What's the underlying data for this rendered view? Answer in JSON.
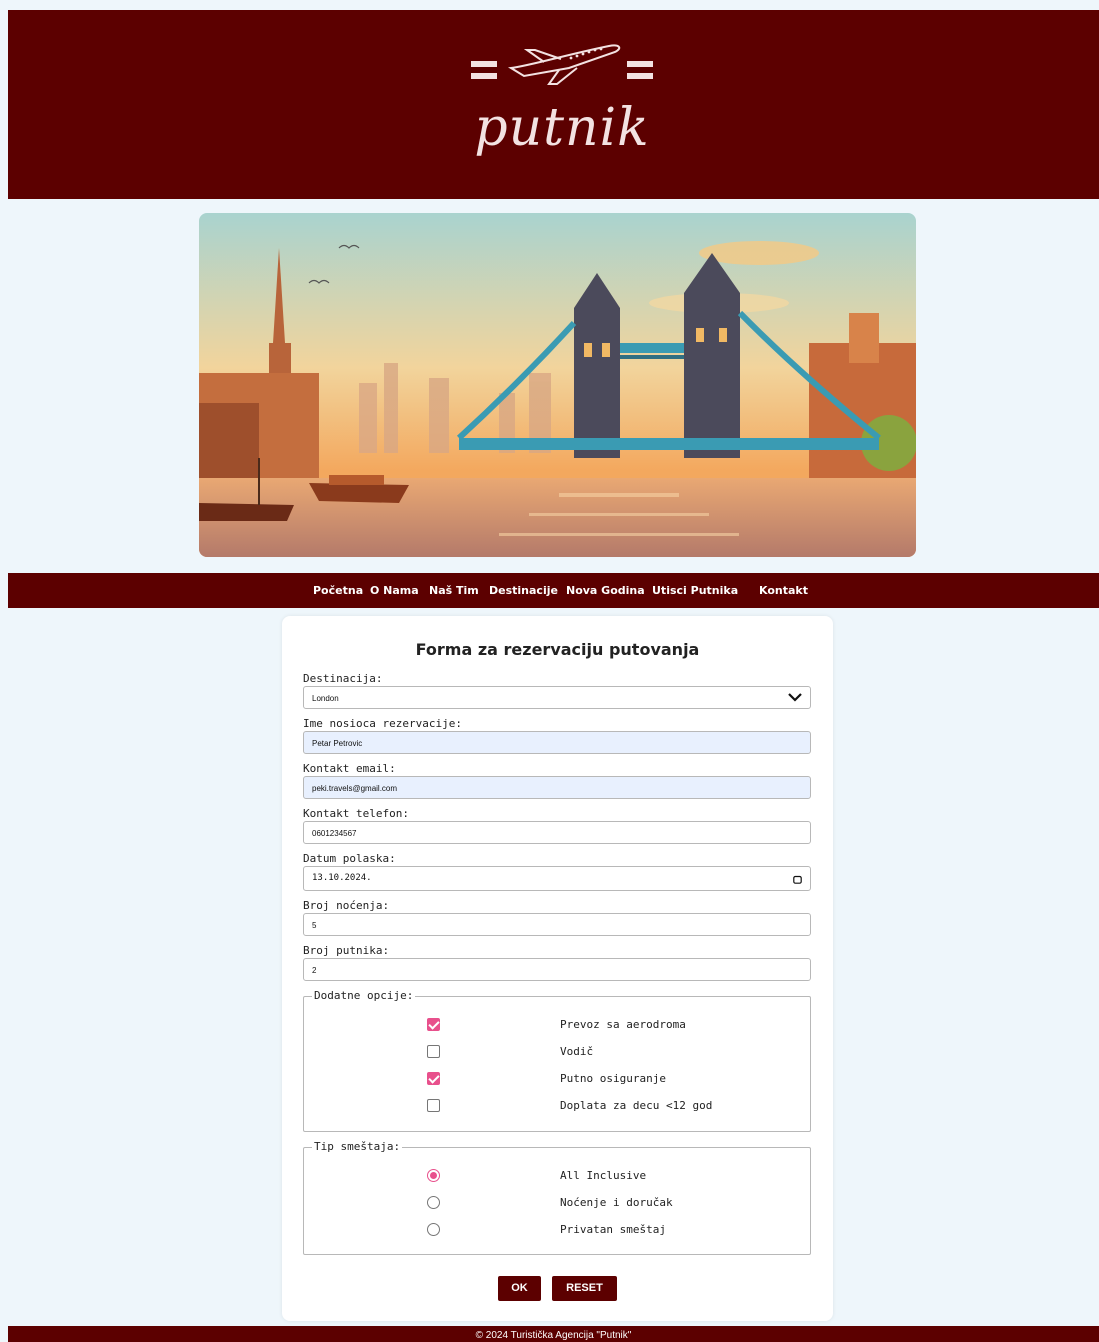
{
  "brand": {
    "logo_text": "putnik"
  },
  "nav": {
    "items": [
      "Početna",
      "O Nama",
      "Naš Tim",
      "Destinacije",
      "Nova Godina",
      "Utisci Putnika",
      "Kontakt"
    ]
  },
  "form": {
    "title": "Forma za rezervaciju putovanja",
    "destination": {
      "label": "Destinacija:",
      "value": "London"
    },
    "holder": {
      "label": "Ime nosioca rezervacije:",
      "value": "Petar Petrovic"
    },
    "email": {
      "label": "Kontakt email:",
      "value": "peki.travels@gmail.com"
    },
    "phone": {
      "label": "Kontakt telefon:",
      "value": "0601234567"
    },
    "date": {
      "label": "Datum polaska:",
      "value": "13.10.2024."
    },
    "nights": {
      "label": "Broj noćenja:",
      "value": "5"
    },
    "travelers": {
      "label": "Broj putnika:",
      "value": "2"
    },
    "extras": {
      "legend": "Dodatne opcije:",
      "options": [
        {
          "label": "Prevoz sa aerodroma",
          "checked": true
        },
        {
          "label": "Vodič",
          "checked": false
        },
        {
          "label": "Putno osiguranje",
          "checked": true
        },
        {
          "label": "Doplata za decu <12 god",
          "checked": false
        }
      ]
    },
    "accommodation": {
      "legend": "Tip smeštaja:",
      "options": [
        {
          "label": "All Inclusive",
          "selected": true
        },
        {
          "label": "Noćenje i doručak",
          "selected": false
        },
        {
          "label": "Privatan smeštaj",
          "selected": false
        }
      ]
    },
    "ok_label": "OK",
    "reset_label": "RESET"
  },
  "footer": {
    "text": "© 2024 Turistička Agencija \"Putnik\""
  },
  "colors": {
    "brand": "#5c0000",
    "accent": "#e8508c",
    "page_bg": "#eef6fb"
  }
}
